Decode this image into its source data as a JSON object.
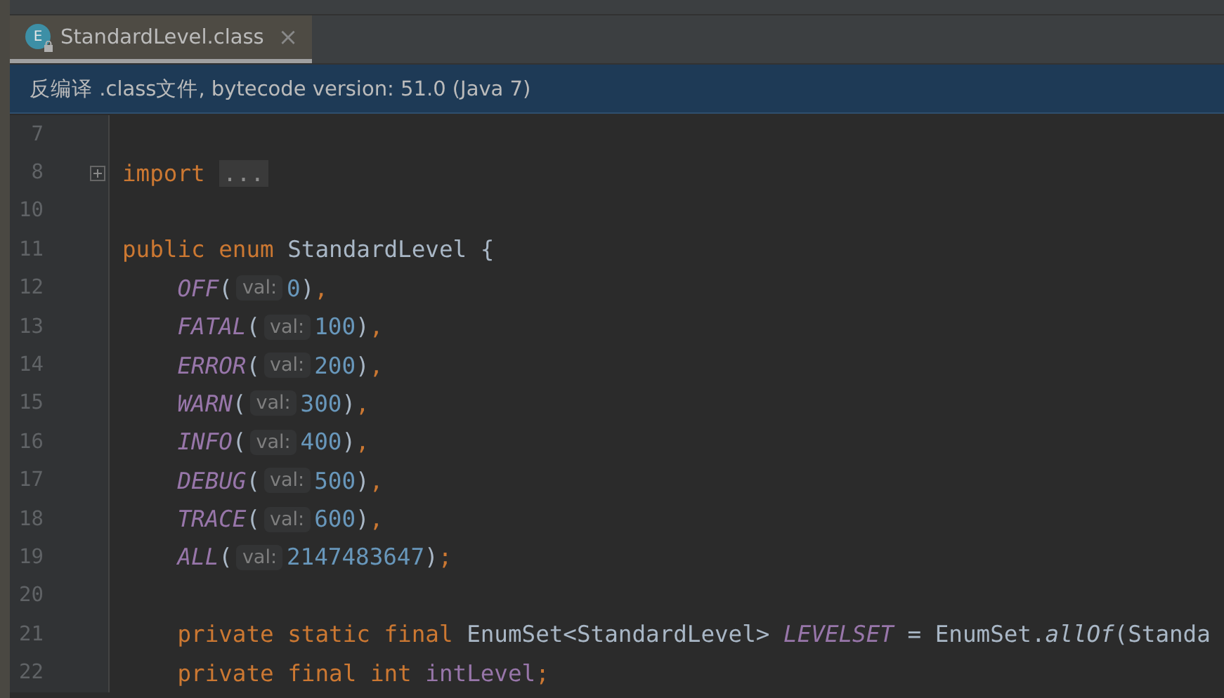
{
  "tabs": [
    {
      "icon_letter": "E",
      "label": "StandardLevel.class",
      "close": "×",
      "selected": true
    }
  ],
  "banner": {
    "text": "反编译 .class文件, bytecode version: 51.0 (Java 7)"
  },
  "editor": {
    "lines": [
      {
        "number": "7",
        "fold_marker": false
      },
      {
        "number": "8",
        "fold_marker": true,
        "tokens": [
          {
            "kind": "keyword",
            "text": "import "
          },
          {
            "kind": "folded",
            "text": "..."
          }
        ]
      },
      {
        "number": "10",
        "fold_marker": false
      },
      {
        "number": "11",
        "fold_marker": false,
        "tokens": [
          {
            "kind": "keyword",
            "text": "public enum"
          },
          {
            "kind": "plain",
            "text": " StandardLevel {"
          }
        ]
      },
      {
        "number": "12",
        "fold_marker": false,
        "tokens": [
          {
            "kind": "constant",
            "text": "    OFF"
          },
          {
            "kind": "plain",
            "text": "("
          },
          {
            "kind": "hint",
            "text": "val:"
          },
          {
            "kind": "number",
            "text": "0"
          },
          {
            "kind": "plain",
            "text": ")"
          },
          {
            "kind": "punct",
            "text": ","
          }
        ]
      },
      {
        "number": "13",
        "fold_marker": false,
        "tokens": [
          {
            "kind": "constant",
            "text": "    FATAL"
          },
          {
            "kind": "plain",
            "text": "("
          },
          {
            "kind": "hint",
            "text": "val:"
          },
          {
            "kind": "number",
            "text": "100"
          },
          {
            "kind": "plain",
            "text": ")"
          },
          {
            "kind": "punct",
            "text": ","
          }
        ]
      },
      {
        "number": "14",
        "fold_marker": false,
        "tokens": [
          {
            "kind": "constant",
            "text": "    ERROR"
          },
          {
            "kind": "plain",
            "text": "("
          },
          {
            "kind": "hint",
            "text": "val:"
          },
          {
            "kind": "number",
            "text": "200"
          },
          {
            "kind": "plain",
            "text": ")"
          },
          {
            "kind": "punct",
            "text": ","
          }
        ]
      },
      {
        "number": "15",
        "fold_marker": false,
        "tokens": [
          {
            "kind": "constant",
            "text": "    WARN"
          },
          {
            "kind": "plain",
            "text": "("
          },
          {
            "kind": "hint",
            "text": "val:"
          },
          {
            "kind": "number",
            "text": "300"
          },
          {
            "kind": "plain",
            "text": ")"
          },
          {
            "kind": "punct",
            "text": ","
          }
        ]
      },
      {
        "number": "16",
        "fold_marker": false,
        "tokens": [
          {
            "kind": "constant",
            "text": "    INFO"
          },
          {
            "kind": "plain",
            "text": "("
          },
          {
            "kind": "hint",
            "text": "val:"
          },
          {
            "kind": "number",
            "text": "400"
          },
          {
            "kind": "plain",
            "text": ")"
          },
          {
            "kind": "punct",
            "text": ","
          }
        ]
      },
      {
        "number": "17",
        "fold_marker": false,
        "tokens": [
          {
            "kind": "constant",
            "text": "    DEBUG"
          },
          {
            "kind": "plain",
            "text": "("
          },
          {
            "kind": "hint",
            "text": "val:"
          },
          {
            "kind": "number",
            "text": "500"
          },
          {
            "kind": "plain",
            "text": ")"
          },
          {
            "kind": "punct",
            "text": ","
          }
        ]
      },
      {
        "number": "18",
        "fold_marker": false,
        "tokens": [
          {
            "kind": "constant",
            "text": "    TRACE"
          },
          {
            "kind": "plain",
            "text": "("
          },
          {
            "kind": "hint",
            "text": "val:"
          },
          {
            "kind": "number",
            "text": "600"
          },
          {
            "kind": "plain",
            "text": ")"
          },
          {
            "kind": "punct",
            "text": ","
          }
        ]
      },
      {
        "number": "19",
        "fold_marker": false,
        "tokens": [
          {
            "kind": "constant",
            "text": "    ALL"
          },
          {
            "kind": "plain",
            "text": "("
          },
          {
            "kind": "hint",
            "text": "val:"
          },
          {
            "kind": "number",
            "text": "2147483647"
          },
          {
            "kind": "plain",
            "text": ")"
          },
          {
            "kind": "punct",
            "text": ";"
          }
        ]
      },
      {
        "number": "20",
        "fold_marker": false
      },
      {
        "number": "21",
        "fold_marker": false,
        "tokens": [
          {
            "kind": "keyword",
            "text": "    private static final"
          },
          {
            "kind": "plain",
            "text": " EnumSet<StandardLevel> "
          },
          {
            "kind": "constant",
            "text": "LEVELSET"
          },
          {
            "kind": "plain",
            "text": " = EnumSet."
          },
          {
            "kind": "static_call",
            "text": "allOf"
          },
          {
            "kind": "plain",
            "text": "(Standa"
          }
        ]
      },
      {
        "number": "22",
        "fold_marker": false,
        "tokens": [
          {
            "kind": "keyword",
            "text": "    private final int "
          },
          {
            "kind": "field",
            "text": "intLevel"
          },
          {
            "kind": "punct",
            "text": ";"
          }
        ]
      }
    ]
  }
}
